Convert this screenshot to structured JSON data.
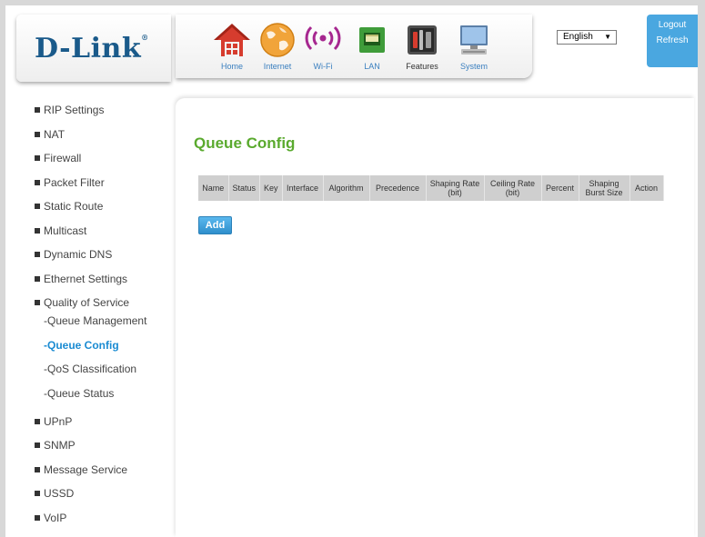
{
  "brand": {
    "logo_text": "D-Link",
    "logo_mark": "®"
  },
  "top_nav": [
    {
      "label": "Home",
      "icon": "home-icon"
    },
    {
      "label": "Internet",
      "icon": "globe-icon"
    },
    {
      "label": "Wi-Fi",
      "icon": "wifi-icon"
    },
    {
      "label": "LAN",
      "icon": "lan-icon"
    },
    {
      "label": "Features",
      "icon": "features-icon"
    },
    {
      "label": "System",
      "icon": "computer-icon"
    }
  ],
  "language": {
    "selected": "English"
  },
  "account": {
    "logout": "Logout",
    "refresh": "Refresh"
  },
  "sidebar": {
    "items": [
      {
        "label": "RIP Settings"
      },
      {
        "label": "NAT"
      },
      {
        "label": "Firewall"
      },
      {
        "label": "Packet Filter"
      },
      {
        "label": "Static Route"
      },
      {
        "label": "Multicast"
      },
      {
        "label": "Dynamic DNS"
      },
      {
        "label": "Ethernet Settings"
      },
      {
        "label": "Quality of Service"
      }
    ],
    "sub_items": [
      {
        "label": "-Queue Management"
      },
      {
        "label": "-Queue Config"
      },
      {
        "label": "-QoS Classification"
      },
      {
        "label": "-Queue Status"
      }
    ],
    "more_items": [
      {
        "label": "UPnP"
      },
      {
        "label": "SNMP"
      },
      {
        "label": "Message Service"
      },
      {
        "label": "USSD"
      },
      {
        "label": "VoIP"
      }
    ]
  },
  "main": {
    "title": "Queue Config",
    "table_headers": [
      "Name",
      "Status",
      "Key",
      "Interface",
      "Algorithm",
      "Precedence",
      "Shaping Rate (bit)",
      "Ceiling Rate (bit)",
      "Percent",
      "Shaping Burst Size",
      "Action"
    ],
    "add_label": "Add"
  },
  "colors": {
    "accent": "#4aa7e0",
    "title_green": "#5aaa2e",
    "active_link": "#1a8bd2",
    "brand_blue": "#1a5a8a"
  }
}
